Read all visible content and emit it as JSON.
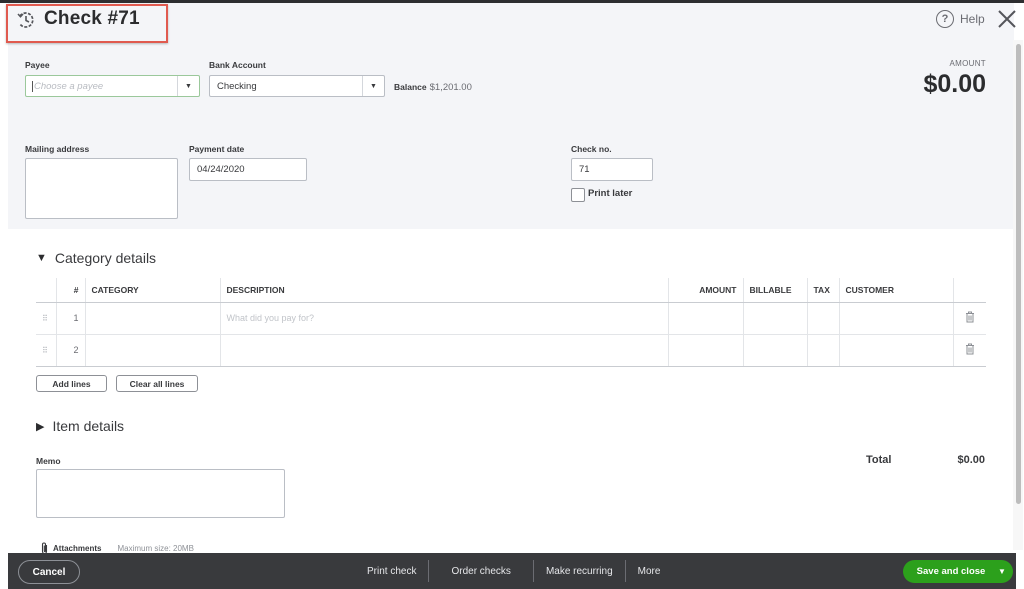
{
  "window": {
    "title": "Check #71",
    "help_label": "Help",
    "icons": {
      "title": "recent-transactions-icon",
      "help": "help-circle-icon",
      "close": "close-x-icon"
    }
  },
  "form": {
    "payee": {
      "label": "Payee",
      "value": "",
      "placeholder": "Choose a payee"
    },
    "bank_account": {
      "label": "Bank Account",
      "value": "Checking"
    },
    "balance": {
      "label": "Balance",
      "value": "$1,201.00"
    },
    "amount": {
      "label": "AMOUNT",
      "value": "$0.00"
    },
    "mailing_address": {
      "label": "Mailing address",
      "value": ""
    },
    "payment_date": {
      "label": "Payment date",
      "value": "04/24/2020"
    },
    "check_no": {
      "label": "Check no.",
      "value": "71"
    },
    "print_later": {
      "label": "Print later",
      "checked": false
    }
  },
  "category_details": {
    "title": "Category details",
    "expanded": true,
    "columns": [
      "#",
      "CATEGORY",
      "DESCRIPTION",
      "AMOUNT",
      "BILLABLE",
      "TAX",
      "CUSTOMER"
    ],
    "rows": [
      {
        "num": "1",
        "category": "",
        "description": "",
        "description_placeholder": "What did you pay for?",
        "amount": "",
        "billable": "",
        "tax": "",
        "customer": ""
      },
      {
        "num": "2",
        "category": "",
        "description": "",
        "description_placeholder": "",
        "amount": "",
        "billable": "",
        "tax": "",
        "customer": ""
      }
    ],
    "add_lines_label": "Add lines",
    "clear_lines_label": "Clear all lines"
  },
  "item_details": {
    "title": "Item details",
    "expanded": false
  },
  "memo": {
    "label": "Memo",
    "value": ""
  },
  "totals": {
    "label": "Total",
    "value": "$0.00"
  },
  "attachments": {
    "label": "Attachments",
    "hint": "Maximum size: 20MB"
  },
  "footer": {
    "cancel_label": "Cancel",
    "links": [
      "Print check",
      "Order checks",
      "Make recurring",
      "More"
    ],
    "save_label": "Save and close"
  },
  "colors": {
    "primary_green": "#2ca01c",
    "footer_bg": "#393a3d",
    "panel_bg": "#f4f5f8",
    "highlight_red": "#e05a4f"
  }
}
